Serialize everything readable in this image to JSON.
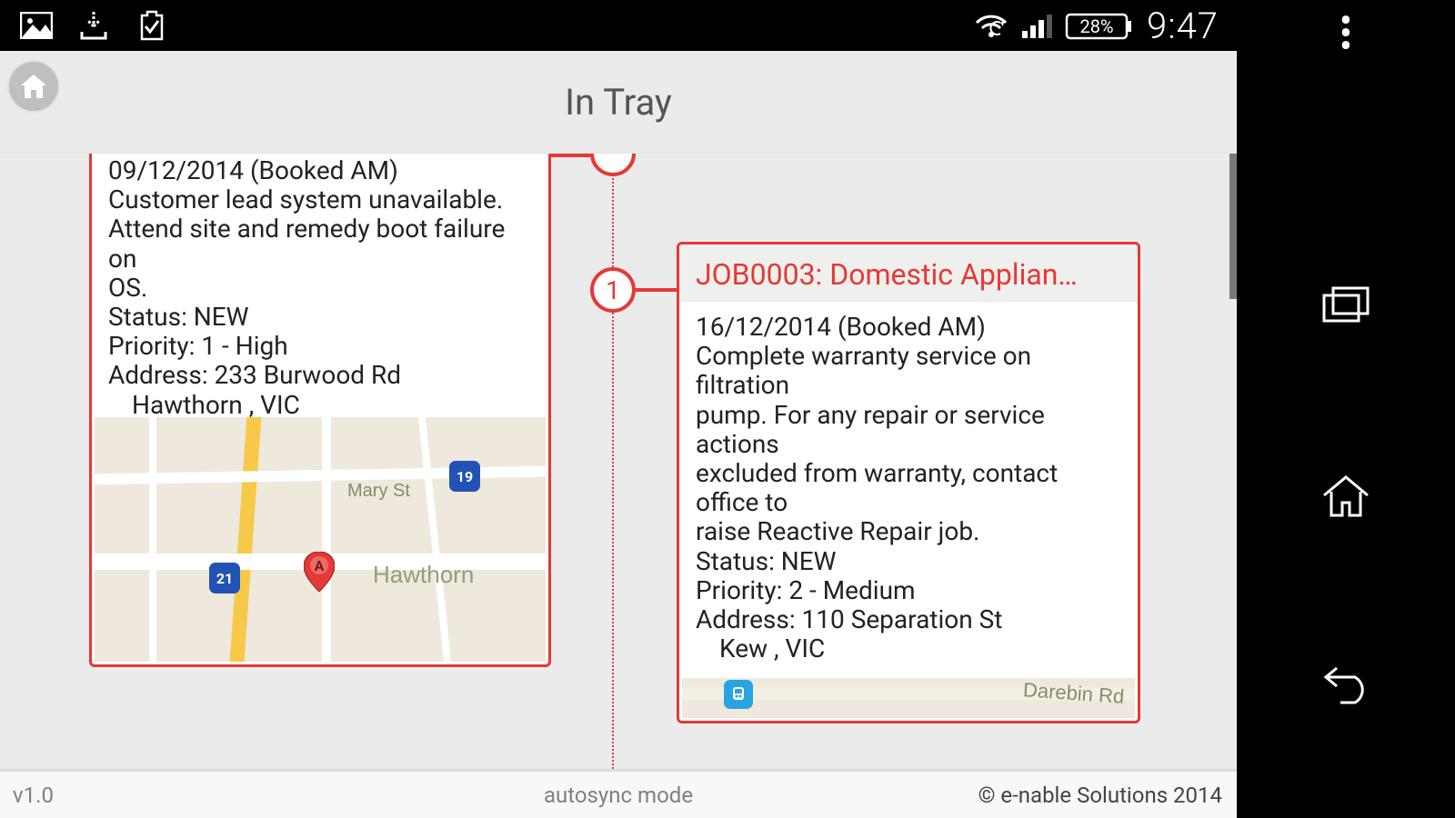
{
  "status": {
    "battery_pct": "28%",
    "clock": "9:47"
  },
  "app": {
    "title": "In Tray",
    "version": "v1.0",
    "mode": "autosync mode",
    "copyright": "© e-nable Solutions 2014"
  },
  "timeline": {
    "node1_label": "1"
  },
  "cards": [
    {
      "date_line": "09/12/2014 (Booked AM)",
      "desc1": "Customer lead system unavailable.",
      "desc2": "Attend site and remedy boot failure on",
      "desc3": "OS.",
      "status": "Status: NEW",
      "priority": "Priority: 1 - High",
      "address1": "Address: 233 Burwood Rd",
      "address2": "Hawthorn , VIC",
      "map": {
        "street": "Mary St",
        "suburb": "Hawthorn",
        "route_a": "19",
        "route_b": "21",
        "pin_label": "A"
      }
    },
    {
      "title": "JOB0003: Domestic Applian…",
      "date_line": "16/12/2014 (Booked AM)",
      "desc1": "Complete warranty service on filtration",
      "desc2": "pump. For any repair or service actions",
      "desc3": "excluded from warranty, contact office to",
      "desc4": "raise Reactive Repair job.",
      "status": "Status: NEW",
      "priority": "Priority: 2 - Medium",
      "address1": "Address: 110 Separation St",
      "address2": "Kew , VIC",
      "map": {
        "street": "Darebin Rd"
      }
    }
  ]
}
